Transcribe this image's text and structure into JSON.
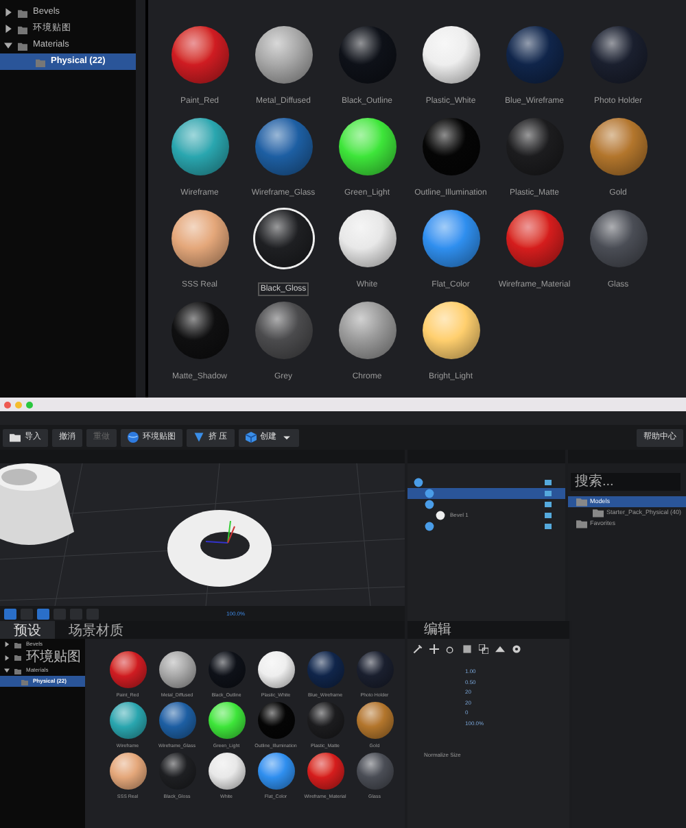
{
  "browser": {
    "tree": [
      {
        "label": "Bevels",
        "expanded": false,
        "selected": false
      },
      {
        "label": "环境贴图",
        "expanded": false,
        "selected": false
      },
      {
        "label": "Materials",
        "expanded": true,
        "selected": false,
        "children": [
          {
            "label": "Physical (22)",
            "selected": true
          }
        ]
      }
    ],
    "materials": [
      {
        "name": "Paint_Red",
        "color": "#d01c22",
        "selected": false
      },
      {
        "name": "Metal_Diffused",
        "color": "#a8a8a8",
        "selected": false
      },
      {
        "name": "Black_Outline",
        "color": "#0e1118",
        "selected": false
      },
      {
        "name": "Plastic_White",
        "color": "#eeeeee",
        "selected": false
      },
      {
        "name": "Blue_Wireframe",
        "color": "#10254a",
        "selected": false
      },
      {
        "name": "Photo Holder",
        "color": "#1a1f2e",
        "selected": false
      },
      {
        "name": "Wireframe",
        "color": "#2aa7b0",
        "selected": false
      },
      {
        "name": "Wireframe_Glass",
        "color": "#1d5fa3",
        "selected": false
      },
      {
        "name": "Green_Light",
        "color": "#3ee63a",
        "selected": false
      },
      {
        "name": "Outline_Illumination",
        "color": "#050505",
        "selected": false
      },
      {
        "name": "Plastic_Matte",
        "color": "#1c1c1e",
        "selected": false
      },
      {
        "name": "Gold",
        "color": "#b3762c",
        "selected": false
      },
      {
        "name": "SSS Real",
        "color": "#e4a77a",
        "selected": false
      },
      {
        "name": "Black_Gloss",
        "color": "#1e1f22",
        "selected": true
      },
      {
        "name": "White",
        "color": "#e8e8e8",
        "selected": false
      },
      {
        "name": "Flat_Color",
        "color": "#2f8fef",
        "selected": false
      },
      {
        "name": "Wireframe_Material",
        "color": "#d61d1d",
        "selected": false
      },
      {
        "name": "Glass",
        "color": "#4a4d55",
        "selected": false
      },
      {
        "name": "Matte_Shadow",
        "color": "#0f0f10",
        "selected": false
      },
      {
        "name": "Grey",
        "color": "#4b4b4d",
        "selected": false
      },
      {
        "name": "Chrome",
        "color": "#9a9a9a",
        "selected": false
      },
      {
        "name": "Bright_Light",
        "color": "#ffcf6e",
        "selected": false
      }
    ]
  },
  "app": {
    "toolbar": [
      {
        "label": "导入",
        "kind": "folder",
        "disabled": false
      },
      {
        "label": "撤消",
        "kind": "plain",
        "disabled": false
      },
      {
        "label": "重做",
        "kind": "plain",
        "disabled": true
      },
      {
        "label": "环境贴图",
        "kind": "globe",
        "disabled": false
      },
      {
        "label": "挤 压",
        "kind": "prism",
        "disabled": false
      },
      {
        "label": "创建",
        "kind": "cube",
        "disabled": false
      }
    ],
    "help": "帮助中心",
    "viewport": {
      "zoom": "100.0%"
    },
    "scene": {
      "rows": [
        {
          "selected": false,
          "children": [
            {
              "selected": true
            },
            {
              "selected": false,
              "children": [
                {
                  "label": "Bevel 1",
                  "selected": false
                }
              ]
            },
            {
              "selected": false
            }
          ]
        }
      ]
    },
    "library": {
      "search": {
        "placeholder": "搜索..."
      },
      "tree": [
        {
          "label": "Models",
          "selected": true,
          "children": [
            {
              "label": "Starter_Pack_Physical (40)",
              "selected": false
            }
          ]
        },
        {
          "label": "Favorites",
          "selected": false
        }
      ]
    },
    "materials_panel": {
      "tabs": [
        {
          "label": "预设",
          "selected": true
        },
        {
          "label": "场景材质",
          "selected": false
        }
      ],
      "tree": [
        {
          "label": "Bevels",
          "expanded": false,
          "selected": false
        },
        {
          "label": "环境贴图",
          "expanded": false,
          "selected": false
        },
        {
          "label": "Materials",
          "expanded": true,
          "selected": false,
          "children": [
            {
              "label": "Physical (22)",
              "selected": true
            }
          ]
        }
      ],
      "materials": [
        {
          "name": "Paint_Red",
          "color": "#d01c22"
        },
        {
          "name": "Metal_Diffused",
          "color": "#a8a8a8"
        },
        {
          "name": "Black_Outline",
          "color": "#0e1118"
        },
        {
          "name": "Plastic_White",
          "color": "#eeeeee"
        },
        {
          "name": "Blue_Wireframe",
          "color": "#10254a"
        },
        {
          "name": "Photo Holder",
          "color": "#1a1f2e"
        },
        {
          "name": "Wireframe",
          "color": "#2aa7b0"
        },
        {
          "name": "Wireframe_Glass",
          "color": "#1d5fa3"
        },
        {
          "name": "Green_Light",
          "color": "#3ee63a"
        },
        {
          "name": "Outline_Illumination",
          "color": "#050505"
        },
        {
          "name": "Plastic_Matte",
          "color": "#1c1c1e"
        },
        {
          "name": "Gold",
          "color": "#b3762c"
        },
        {
          "name": "SSS Real",
          "color": "#e4a77a"
        },
        {
          "name": "Black_Gloss",
          "color": "#1e1f22"
        },
        {
          "name": "White",
          "color": "#e8e8e8"
        },
        {
          "name": "Flat_Color",
          "color": "#2f8fef"
        },
        {
          "name": "Wireframe_Material",
          "color": "#d61d1d"
        },
        {
          "name": "Glass",
          "color": "#4a4d55"
        }
      ]
    },
    "properties": {
      "tab": "编辑",
      "values": [
        "1.00",
        "0.50",
        "20",
        "20",
        "0"
      ],
      "normalize_label": "Normalize Size",
      "scale": "100.0%"
    }
  }
}
